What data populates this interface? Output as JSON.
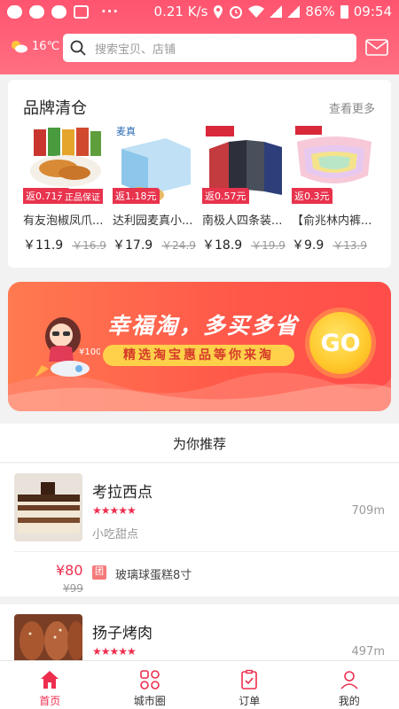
{
  "status_bar": {
    "speed": "0.21 K/s",
    "battery": "86%",
    "time": "09:54",
    "dots": "···"
  },
  "header": {
    "temperature": "16℃",
    "search_placeholder": "搜索宝贝、店铺",
    "accent_color": "#ff5a74"
  },
  "brand": {
    "title": "品牌清仓",
    "more": "查看更多",
    "products": [
      {
        "name": "有友泡椒凤爪...",
        "price": "￥11.9",
        "original": "￥16.9",
        "rebate": "返0.71元",
        "badge": "正品保证"
      },
      {
        "name": "达利园麦真小...",
        "price": "￥17.9",
        "original": "￥24.9",
        "rebate": "返1.18元",
        "badge": ""
      },
      {
        "name": "南极人四条装...",
        "price": "￥18.9",
        "original": "￥19.9",
        "rebate": "返0.57元",
        "badge": ""
      },
      {
        "name": "【俞兆林内裤...",
        "price": "￥9.9",
        "original": "￥13.9",
        "rebate": "返0.3元",
        "badge": ""
      }
    ]
  },
  "banner": {
    "title": "幸福淘，多买多省",
    "subtitle": "精选淘宝惠品等你来淘",
    "go": "GO",
    "rocket_label": "¥100"
  },
  "recommend": {
    "title": "为你推荐",
    "shops": [
      {
        "name": "考拉西点",
        "stars": "★★★★★",
        "distance": "709m",
        "category": "小吃甜点",
        "deal_price": "¥80",
        "deal_original": "¥99",
        "deal_tag": "团",
        "deal_name": "玻璃球蛋糕8寸"
      },
      {
        "name": "扬子烤肉",
        "stars": "★★★★★",
        "distance": "497m"
      }
    ]
  },
  "tabbar": {
    "items": [
      {
        "label": "首页",
        "icon": "home-icon",
        "active": true
      },
      {
        "label": "城市圈",
        "icon": "city-circle-icon",
        "active": false
      },
      {
        "label": "订单",
        "icon": "order-icon",
        "active": false
      },
      {
        "label": "我的",
        "icon": "profile-icon",
        "active": false
      }
    ]
  }
}
